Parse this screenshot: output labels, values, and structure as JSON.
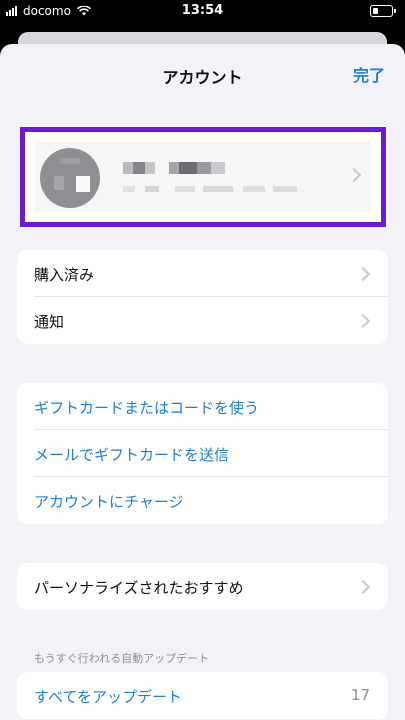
{
  "status_bar": {
    "carrier": "docomo",
    "time": "13:54"
  },
  "nav": {
    "title": "アカウント",
    "done_label": "完了"
  },
  "group1": [
    {
      "label": "購入済み"
    },
    {
      "label": "通知"
    }
  ],
  "group2": [
    {
      "label": "ギフトカードまたはコードを使う"
    },
    {
      "label": "メールでギフトカードを送信"
    },
    {
      "label": "アカウントにチャージ"
    }
  ],
  "group3": [
    {
      "label": "パーソナライズされたおすすめ"
    }
  ],
  "updates": {
    "caption": "もうすぐ行われる自動アップデート",
    "update_all_label": "すべてをアップデート",
    "count": "17"
  },
  "colors": {
    "accent": "#1a7fd6",
    "highlight_border": "#6a1bd6"
  }
}
